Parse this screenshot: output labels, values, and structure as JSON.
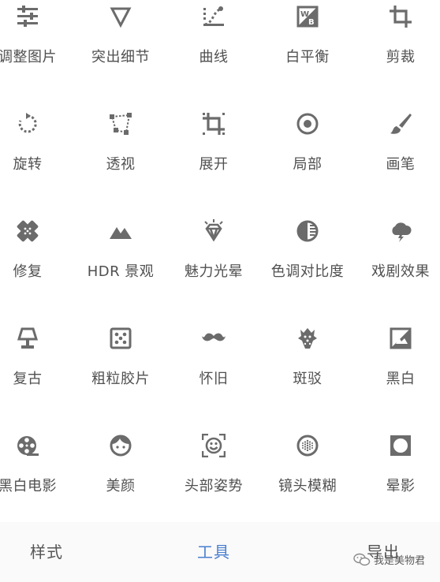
{
  "tools": [
    {
      "label": "调整图片",
      "icon": "sliders-icon"
    },
    {
      "label": "突出细节",
      "icon": "triangle-down-icon"
    },
    {
      "label": "曲线",
      "icon": "curve-icon"
    },
    {
      "label": "白平衡",
      "icon": "white-balance-icon"
    },
    {
      "label": "剪裁",
      "icon": "crop-icon"
    },
    {
      "label": "旋转",
      "icon": "rotate-icon"
    },
    {
      "label": "透视",
      "icon": "perspective-icon"
    },
    {
      "label": "展开",
      "icon": "expand-icon"
    },
    {
      "label": "局部",
      "icon": "selective-icon"
    },
    {
      "label": "画笔",
      "icon": "brush-icon"
    },
    {
      "label": "修复",
      "icon": "healing-icon"
    },
    {
      "label": "HDR 景观",
      "icon": "mountains-icon"
    },
    {
      "label": "魅力光晕",
      "icon": "diamond-icon"
    },
    {
      "label": "色调对比度",
      "icon": "tonal-contrast-icon"
    },
    {
      "label": "戏剧效果",
      "icon": "drama-cloud-icon"
    },
    {
      "label": "复古",
      "icon": "lamp-icon"
    },
    {
      "label": "粗粒胶片",
      "icon": "dice-icon"
    },
    {
      "label": "怀旧",
      "icon": "mustache-icon"
    },
    {
      "label": "斑驳",
      "icon": "grunge-icon"
    },
    {
      "label": "黑白",
      "icon": "black-white-icon"
    },
    {
      "label": "黑白电影",
      "icon": "film-reel-icon"
    },
    {
      "label": "美颜",
      "icon": "face-icon"
    },
    {
      "label": "头部姿势",
      "icon": "head-pose-icon"
    },
    {
      "label": "镜头模糊",
      "icon": "lens-blur-icon"
    },
    {
      "label": "晕影",
      "icon": "vignette-icon"
    }
  ],
  "tabs": {
    "styles": "样式",
    "tools": "工具",
    "export": "导出"
  },
  "watermark": {
    "text": "我是美物君",
    "icon": "wechat-icon"
  },
  "colors": {
    "icon": "#6b6b6b",
    "active_tab": "#4a7fd0",
    "text": "#505050"
  }
}
